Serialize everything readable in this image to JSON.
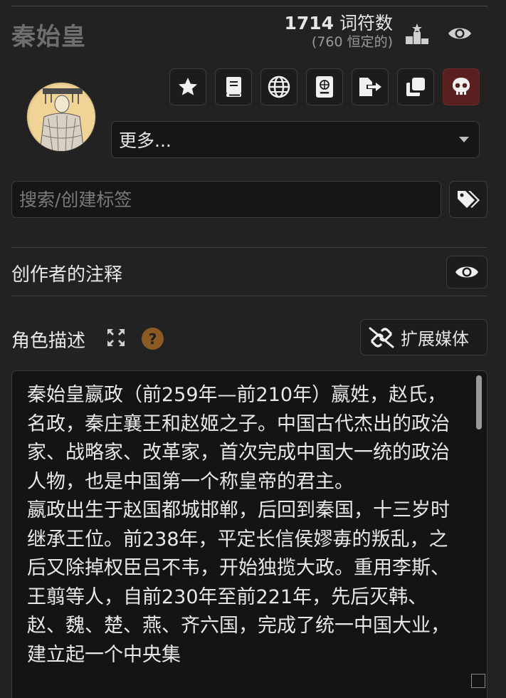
{
  "character": {
    "name": "秦始皇",
    "token_count": "1714",
    "token_label": "词符数",
    "permanent_tokens": "(760 恒定的)"
  },
  "toolbar": {
    "buttons": [
      {
        "name": "favorite-button",
        "icon": "star-icon"
      },
      {
        "name": "lore-book-button",
        "icon": "book-icon"
      },
      {
        "name": "world-info-button",
        "icon": "globe-icon"
      },
      {
        "name": "passport-button",
        "icon": "passport-icon"
      },
      {
        "name": "export-button",
        "icon": "export-icon"
      },
      {
        "name": "duplicate-button",
        "icon": "clone-icon"
      },
      {
        "name": "delete-button",
        "icon": "skull-icon",
        "color": "#5a2020"
      }
    ],
    "more_select": "更多..."
  },
  "tags": {
    "placeholder": "搜索/创建标签"
  },
  "creator_notes": {
    "label": "创作者的注释"
  },
  "description": {
    "label": "角色描述",
    "help": "?",
    "media_button": "扩展媒体",
    "text": "秦始皇嬴政（前259年—前210年）嬴姓，赵氏，名政，秦庄襄王和赵姬之子。中国古代杰出的政治家、战略家、改革家，首次完成中国大一统的政治人物，也是中国第一个称皇帝的君主。\n嬴政出生于赵国都城邯郸，后回到秦国，十三岁时继承王位。前238年，平定长信侯嫪毐的叛乱，之后又除掉权臣吕不韦，开始独揽大政。重用李斯、王翦等人，自前230年至前221年，先后灭韩、赵、魏、楚、燕、齐六国，完成了统一中国大业，建立起一个中央集"
  },
  "colors": {
    "background": "#222222",
    "help_badge": "#8a5a22",
    "danger": "#5a2020"
  }
}
